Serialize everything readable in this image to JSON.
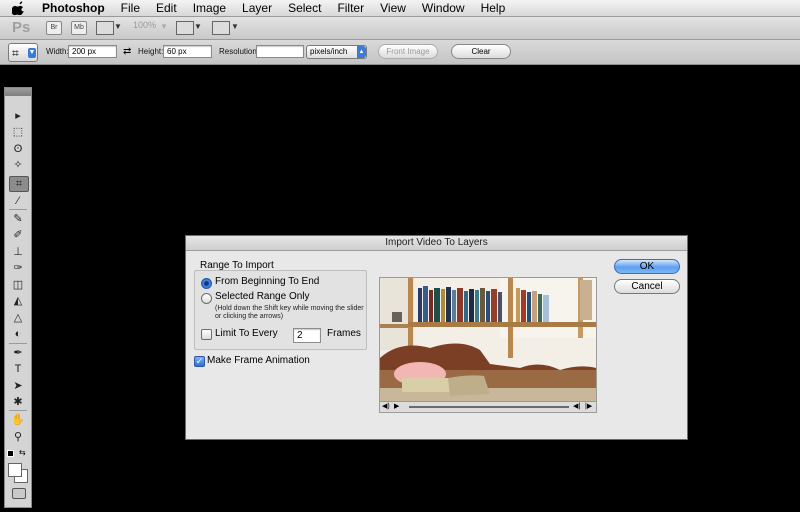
{
  "menubar": {
    "app": "Photoshop",
    "items": [
      "File",
      "Edit",
      "Image",
      "Layer",
      "Select",
      "Filter",
      "View",
      "Window",
      "Help"
    ]
  },
  "appbar": {
    "logo": "Ps",
    "bridge_label": "Br",
    "minibridge_label": "Mb",
    "zoom": "100%"
  },
  "options": {
    "width_label": "Width:",
    "width_value": "200 px",
    "height_label": "Height:",
    "height_value": "60 px",
    "resolution_label": "Resolution:",
    "resolution_value": "",
    "unit": "pixels/inch",
    "front_image_label": "Front Image",
    "clear_label": "Clear"
  },
  "dialog": {
    "title": "Import Video To Layers",
    "range_title": "Range To Import",
    "opt_begin": "From Beginning To End",
    "opt_selected": "Selected Range Only",
    "hint": "(Hold down the Shift key while moving the slider or clicking the arrows)",
    "limit_label": "Limit To Every",
    "limit_value": "2",
    "frames_label": "Frames",
    "make_anim_label": "Make Frame Animation",
    "ok_label": "OK",
    "cancel_label": "Cancel",
    "selected_option": "From Beginning To End",
    "limit_checked": false,
    "make_anim_checked": true
  },
  "colors": {
    "accent": "#3b7bd8",
    "canvas_bg": "#000000"
  }
}
